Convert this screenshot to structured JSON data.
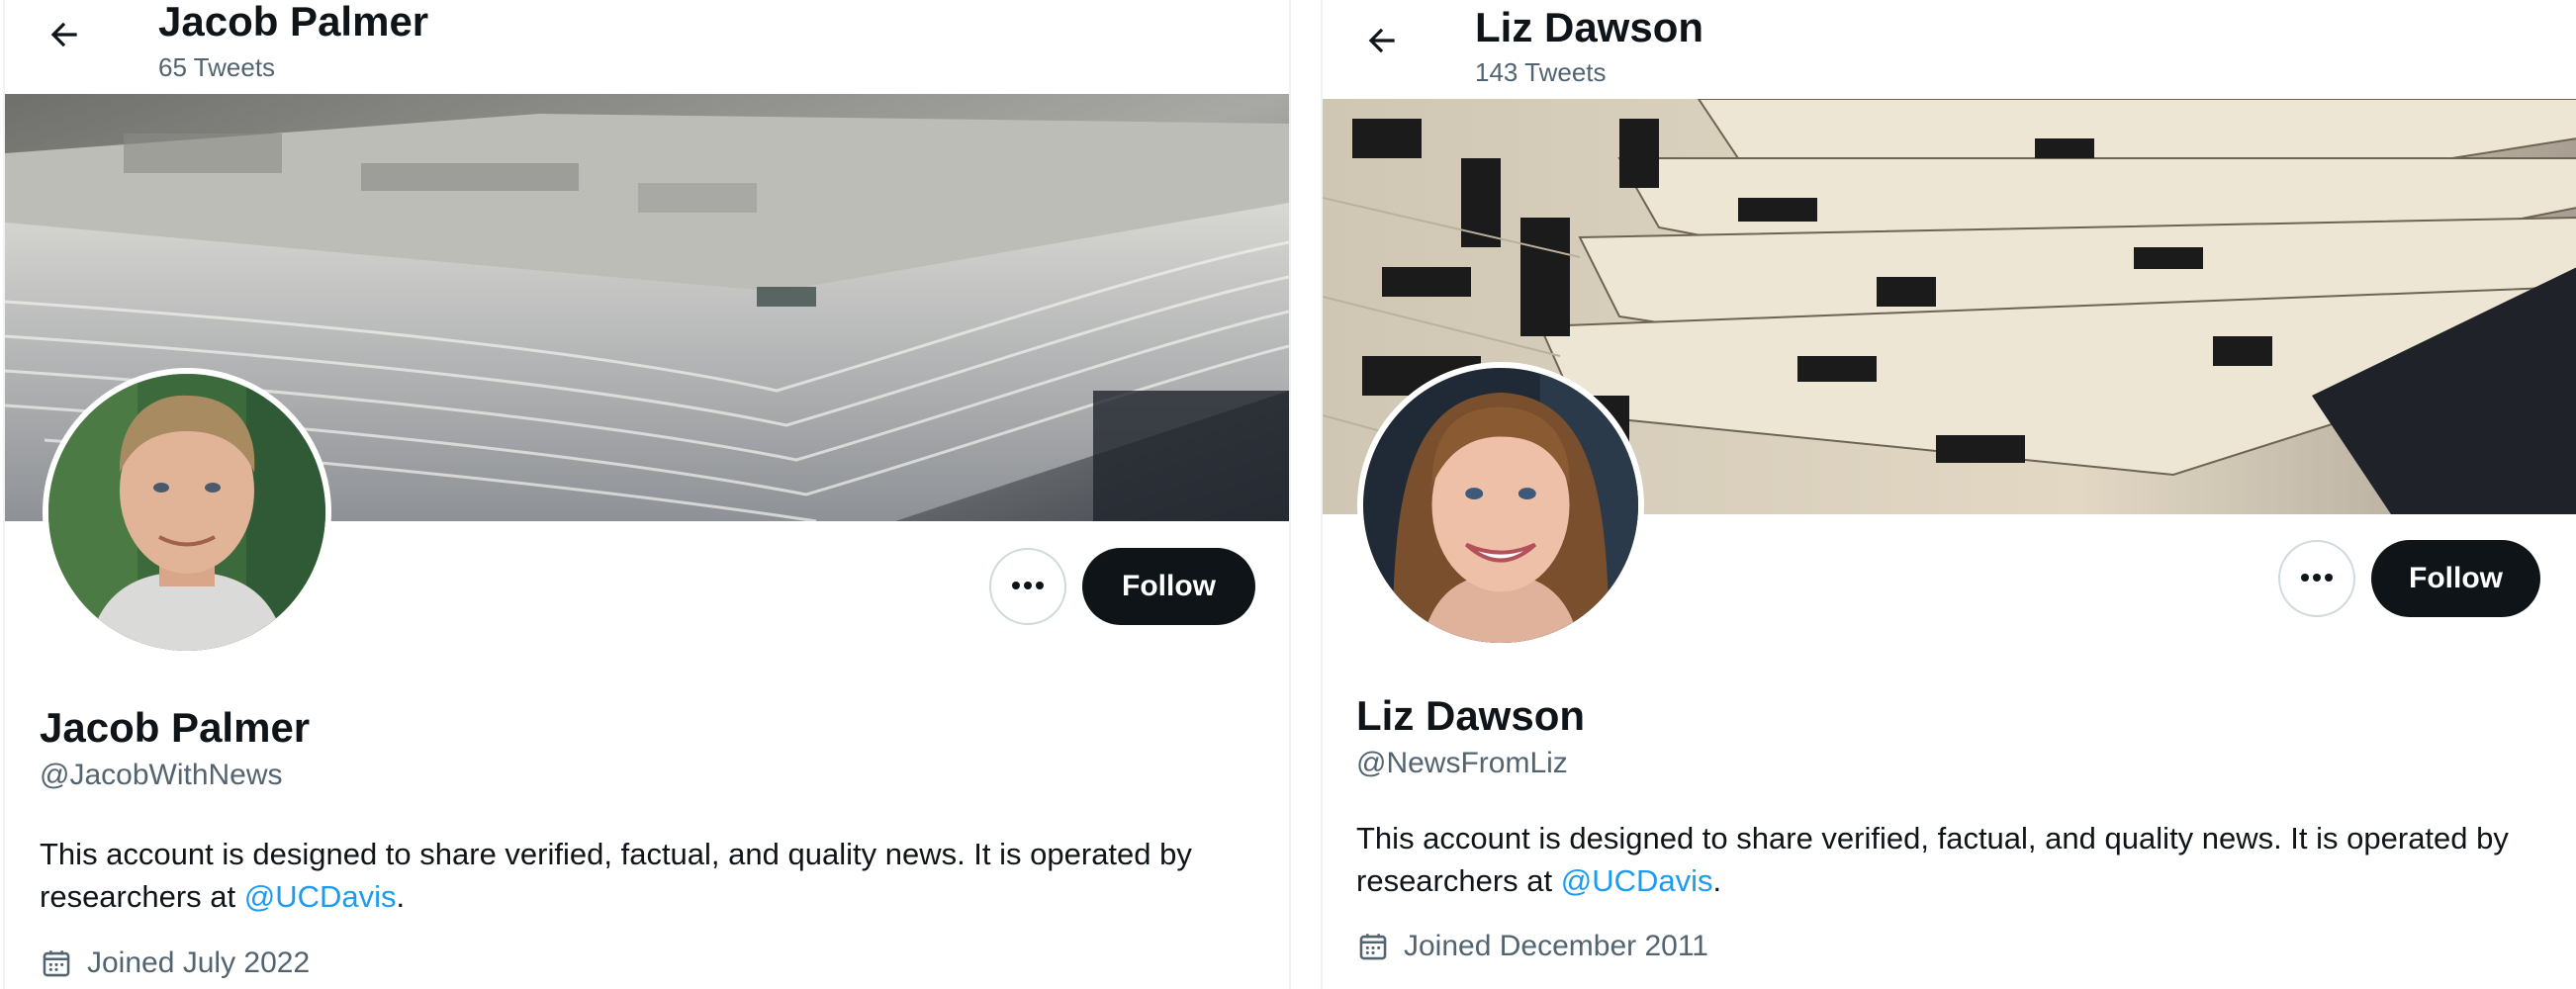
{
  "profiles": [
    {
      "header": {
        "name": "Jacob Palmer",
        "tweet_count": "65 Tweets"
      },
      "name": "Jacob Palmer",
      "handle": "@JacobWithNews",
      "bio": {
        "text": "This account is designed to share verified, factual, and quality news. It is operated by researchers at ",
        "mention": "@UCDavis",
        "suffix": "."
      },
      "joined": "Joined July 2022",
      "follow_label": "Follow",
      "icons": {
        "back": "arrow-left-icon",
        "more": "more-horizontal-icon",
        "calendar": "calendar-icon"
      }
    },
    {
      "header": {
        "name": "Liz Dawson",
        "tweet_count": "143 Tweets"
      },
      "name": "Liz Dawson",
      "handle": "@NewsFromLiz",
      "bio": {
        "text": "This account is designed to share verified, factual, and quality news. It is operated by researchers at ",
        "mention": "@UCDavis",
        "suffix": "."
      },
      "joined": "Joined December 2011",
      "follow_label": "Follow",
      "icons": {
        "back": "arrow-left-icon",
        "more": "more-horizontal-icon",
        "calendar": "calendar-icon"
      }
    }
  ],
  "colors": {
    "text_primary": "#0f1419",
    "text_secondary": "#536471",
    "mention": "#1d9bf0",
    "follow_button_bg": "#0f1419",
    "border": "#cfd9de"
  }
}
